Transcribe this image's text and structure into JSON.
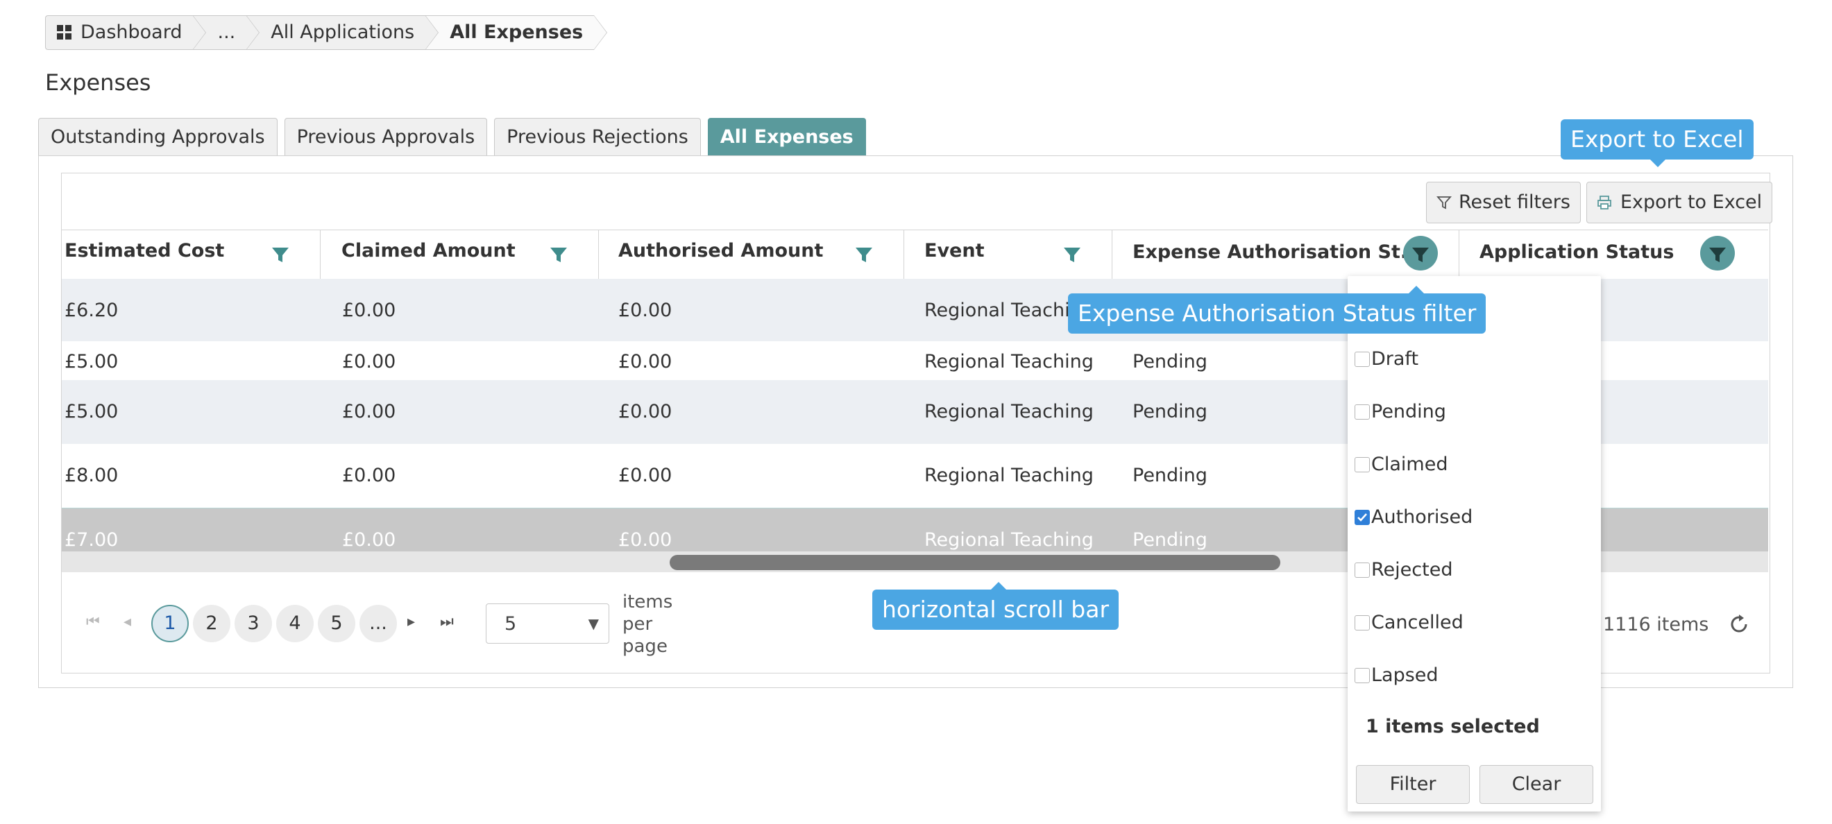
{
  "breadcrumb": [
    "Dashboard",
    "...",
    "All Applications",
    "All Expenses"
  ],
  "page_title": "Expenses",
  "tabs": [
    "Outstanding Approvals",
    "Previous Approvals",
    "Previous Rejections",
    "All Expenses"
  ],
  "active_tab": "All Expenses",
  "toolbar": {
    "reset_label": "Reset filters",
    "export_label": "Export to Excel"
  },
  "columns": [
    "Estimated Cost",
    "Claimed Amount",
    "Authorised Amount",
    "Event",
    "Expense Authorisation St...",
    "Application Status"
  ],
  "rows": [
    {
      "cost": "£6.20",
      "claimed": "£0.00",
      "authorised": "£0.00",
      "event": "Regional Teachin",
      "status": ""
    },
    {
      "cost": "£5.00",
      "claimed": "£0.00",
      "authorised": "£0.00",
      "event": "Regional Teaching",
      "status": "Pending"
    },
    {
      "cost": "£5.00",
      "claimed": "£0.00",
      "authorised": "£0.00",
      "event": "Regional Teaching",
      "status": "Pending"
    },
    {
      "cost": "£8.00",
      "claimed": "£0.00",
      "authorised": "£0.00",
      "event": "Regional Teaching",
      "status": "Pending"
    },
    {
      "cost": "£7.00",
      "claimed": "£0.00",
      "authorised": "£0.00",
      "event": "Regional Teaching",
      "status": "Pending"
    }
  ],
  "pager": {
    "pages": [
      "1",
      "2",
      "3",
      "4",
      "5",
      "..."
    ],
    "current_page": "1",
    "page_size": "5",
    "items_per_page_label": "items\nper\npage",
    "total_label": "1116 items"
  },
  "filter_popup": {
    "options": [
      {
        "label": "Draft",
        "checked": false
      },
      {
        "label": "Pending",
        "checked": false
      },
      {
        "label": "Claimed",
        "checked": false
      },
      {
        "label": "Authorised",
        "checked": true
      },
      {
        "label": "Rejected",
        "checked": false
      },
      {
        "label": "Cancelled",
        "checked": false
      },
      {
        "label": "Lapsed",
        "checked": false
      }
    ],
    "selected_summary": "1 items selected",
    "filter_label": "Filter",
    "clear_label": "Clear"
  },
  "annotations": {
    "export": "Export to Excel",
    "status_filter": "Expense Authorisation Status filter",
    "scrollbar": "horizontal scroll bar"
  },
  "colors": {
    "accent": "#5a9a9c",
    "tooltip": "#4ba6e3",
    "row_alt": "#eceff3",
    "row_selected": "#c8c8c8"
  }
}
